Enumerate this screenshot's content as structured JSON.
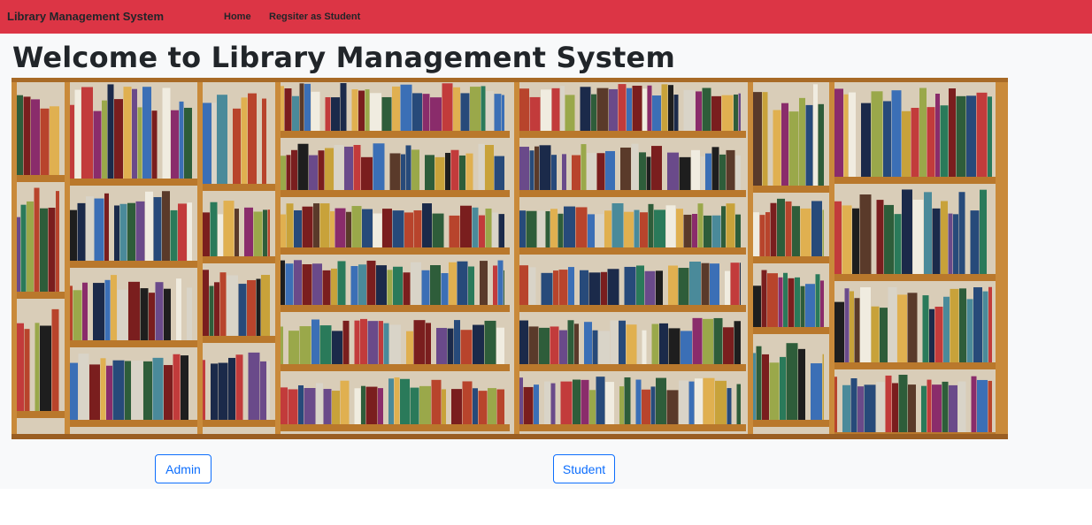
{
  "navbar": {
    "brand": "Library Management System",
    "links": [
      {
        "label": "Home"
      },
      {
        "label": "Regsiter as Student"
      }
    ],
    "color": "#dc3545"
  },
  "main": {
    "title": "Welcome to Library Management System",
    "image": {
      "subject": "library bookshelves photo"
    },
    "buttons": [
      {
        "label": "Admin"
      },
      {
        "label": "Student"
      }
    ],
    "button_color": "#0d6efd"
  }
}
